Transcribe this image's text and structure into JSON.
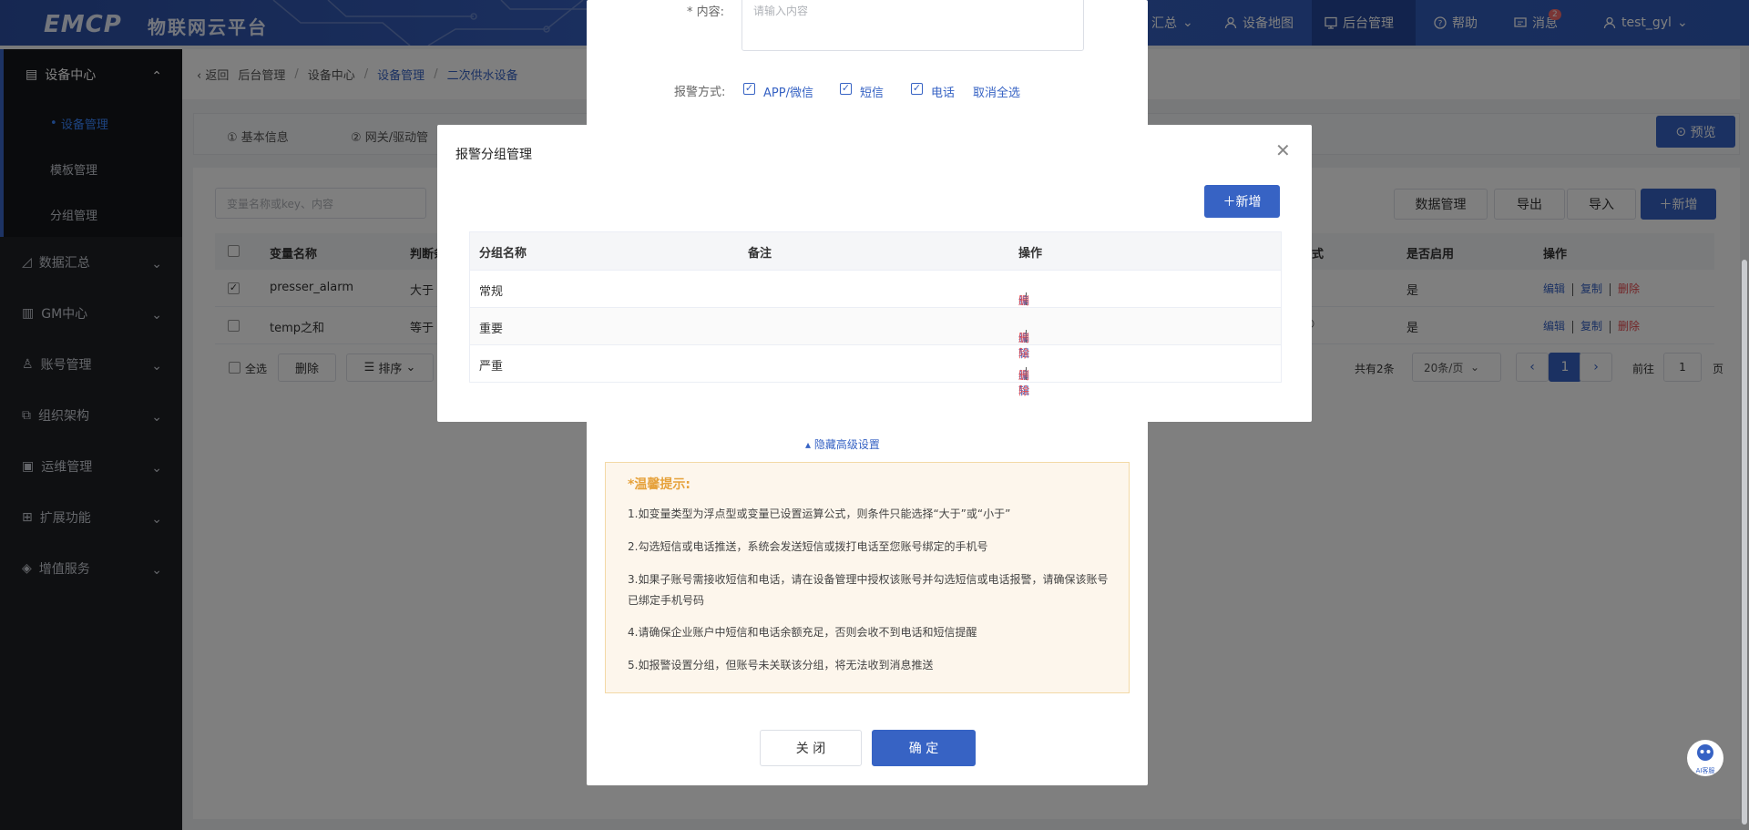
{
  "header": {
    "logo": "EMCP",
    "platform": "物联网云平台",
    "nav": [
      {
        "label": "汇总"
      },
      {
        "label": "设备地图"
      },
      {
        "label": "后台管理"
      },
      {
        "label": "帮助"
      },
      {
        "label": "消息"
      },
      {
        "label": "test_gyl"
      }
    ],
    "msg_count": "2"
  },
  "sidebar": {
    "groups": [
      {
        "label": "设备中心"
      },
      {
        "label": "数据汇总"
      },
      {
        "label": "GM中心"
      },
      {
        "label": "账号管理"
      },
      {
        "label": "组织架构"
      },
      {
        "label": "运维管理"
      },
      {
        "label": "扩展功能"
      },
      {
        "label": "增值服务"
      }
    ],
    "subitems": [
      {
        "label": "设备管理"
      },
      {
        "label": "模板管理"
      },
      {
        "label": "分组管理"
      }
    ]
  },
  "breadcrumb": {
    "back": "返回",
    "items": [
      "后台管理",
      "设备中心",
      "设备管理",
      "二次供水设备"
    ]
  },
  "tabs": [
    {
      "label": "① 基本信息"
    },
    {
      "label": "② 网关/驱动管"
    }
  ],
  "preview_label": "预览",
  "search": {
    "placeholder": "变量名称或key、内容"
  },
  "toolbar": {
    "data_mgmt": "数据管理",
    "export": "导出",
    "import": "导入",
    "add": "新增"
  },
  "table": {
    "headers": {
      "name": "变量名称",
      "cond": "判断条",
      "mode": "式",
      "enabled": "是否启用",
      "ops": "操作"
    },
    "rows": [
      {
        "name": "presser_alarm",
        "cond": "大于",
        "enabled": "是",
        "checked": true
      },
      {
        "name": "temp之和",
        "cond": "等于",
        "enabled": "是",
        "checked": false
      }
    ],
    "ops": {
      "edit": "编辑",
      "copy": "复制",
      "delete": "删除"
    }
  },
  "footer": {
    "select_all": "全选",
    "delete": "删除",
    "sort": "排序",
    "total": "共有2条",
    "page_size": "20条/页",
    "current_page": "1",
    "goto": "前往",
    "goto_page": "1",
    "page_unit": "页"
  },
  "panel": {
    "content_label": "* 内容:",
    "content_placeholder": "请输入内容",
    "alarm_method_label": "报警方式:",
    "methods": [
      {
        "label": "APP/微信"
      },
      {
        "label": "短信"
      },
      {
        "label": "电话"
      }
    ],
    "cancel_all": "取消全选",
    "hide_advanced": "隐藏高级设置",
    "tips_title": "*温馨提示:",
    "tips": [
      "1.如变量类型为浮点型或变量已设置运算公式，则条件只能选择“大于”或“小于”",
      "2.勾选短信或电话推送，系统会发送短信或拨打电话至您账号绑定的手机号",
      "3.如果子账号需接收短信和电话，请在设备管理中授权该账号并勾选短信或电话报警，请确保该账号已绑定手机号码",
      "4.请确保企业账户中短信和电话余额充足，否则会收不到电话和短信提醒",
      "5.如报警设置分组，但账号未关联该分组，将无法收到消息推送"
    ],
    "close": "关 闭",
    "confirm": "确 定"
  },
  "dialog": {
    "title": "报警分组管理",
    "add": "新增",
    "headers": {
      "name": "分组名称",
      "remark": "备注",
      "ops": "操作"
    },
    "rows": [
      {
        "name": "常规",
        "remark": ""
      },
      {
        "name": "重要",
        "remark": ""
      },
      {
        "name": "严重",
        "remark": ""
      }
    ],
    "edit": "编辑",
    "delete": "删除"
  },
  "ai_label": "AI客服",
  "colors": {
    "primary": "#3763c4",
    "danger": "#e5484d",
    "header": "#2f5ab8",
    "sidebar": "#1f2024"
  }
}
